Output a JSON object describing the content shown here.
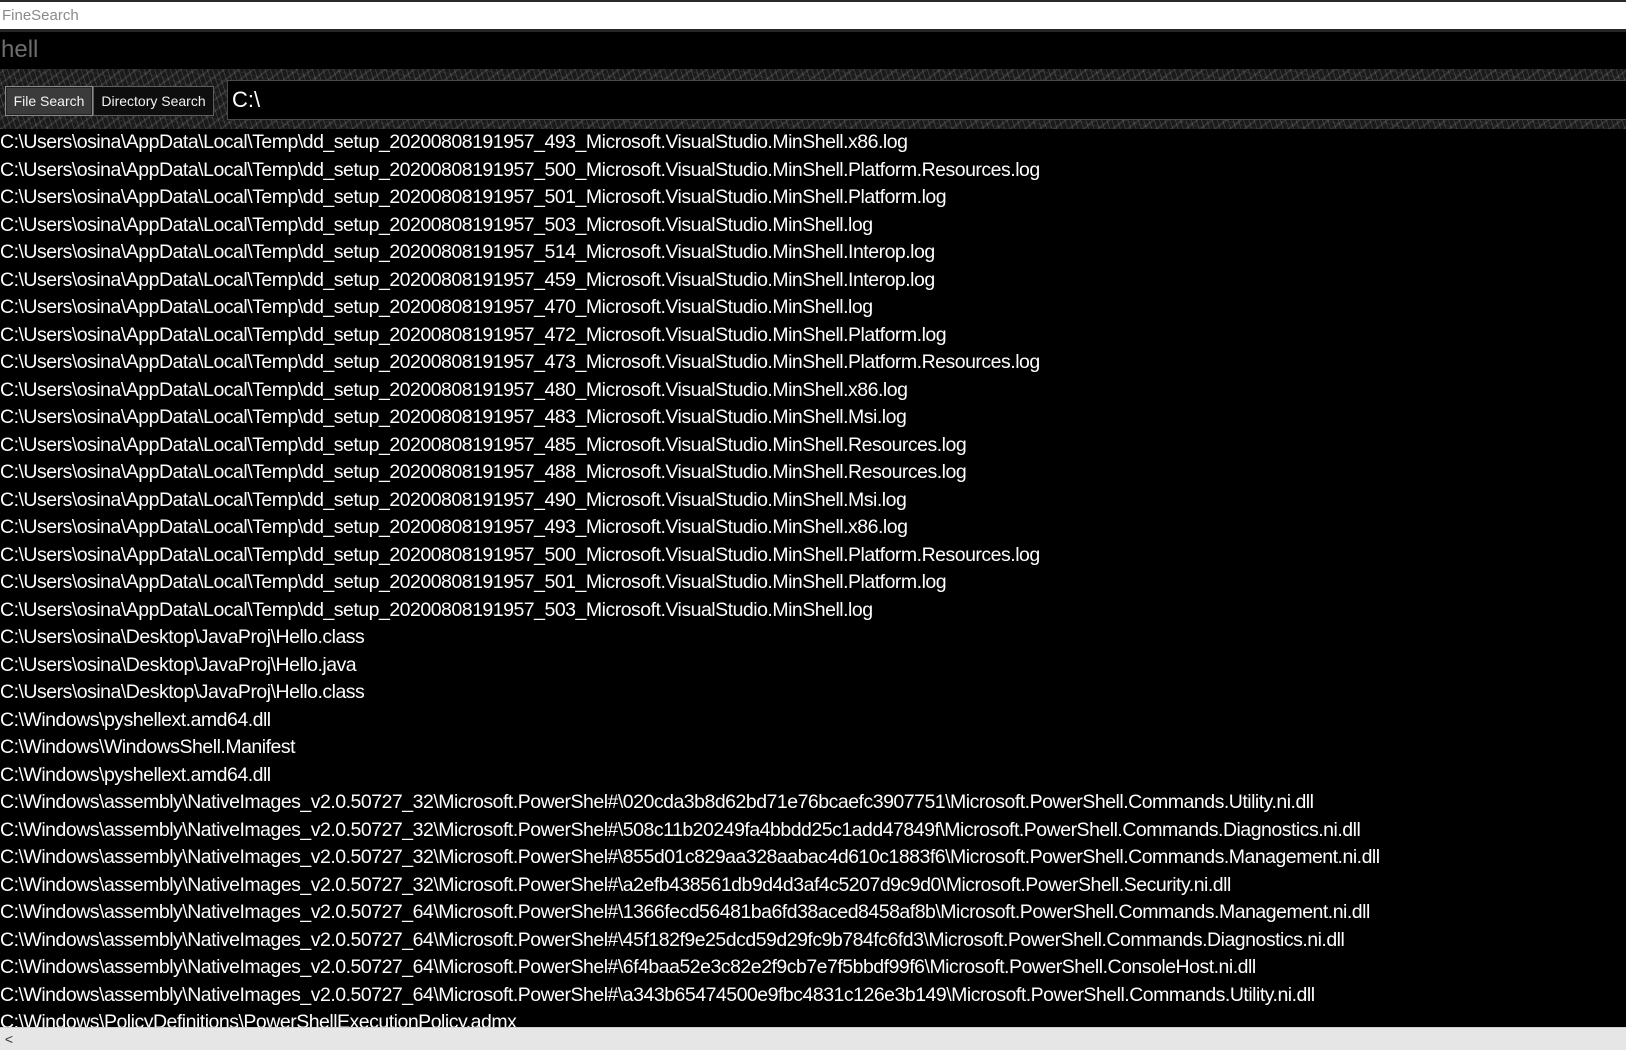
{
  "window": {
    "title": "FineSearch"
  },
  "query": {
    "text": "hell"
  },
  "toolbar": {
    "file_search_label": "File Search",
    "directory_search_label": "Directory Search"
  },
  "path_input": {
    "value": "C:\\"
  },
  "results": [
    "C:\\Users\\osina\\AppData\\Local\\Temp\\dd_setup_20200808191957_493_Microsoft.VisualStudio.MinShell.x86.log",
    "C:\\Users\\osina\\AppData\\Local\\Temp\\dd_setup_20200808191957_500_Microsoft.VisualStudio.MinShell.Platform.Resources.log",
    "C:\\Users\\osina\\AppData\\Local\\Temp\\dd_setup_20200808191957_501_Microsoft.VisualStudio.MinShell.Platform.log",
    "C:\\Users\\osina\\AppData\\Local\\Temp\\dd_setup_20200808191957_503_Microsoft.VisualStudio.MinShell.log",
    "C:\\Users\\osina\\AppData\\Local\\Temp\\dd_setup_20200808191957_514_Microsoft.VisualStudio.MinShell.Interop.log",
    "C:\\Users\\osina\\AppData\\Local\\Temp\\dd_setup_20200808191957_459_Microsoft.VisualStudio.MinShell.Interop.log",
    "C:\\Users\\osina\\AppData\\Local\\Temp\\dd_setup_20200808191957_470_Microsoft.VisualStudio.MinShell.log",
    "C:\\Users\\osina\\AppData\\Local\\Temp\\dd_setup_20200808191957_472_Microsoft.VisualStudio.MinShell.Platform.log",
    "C:\\Users\\osina\\AppData\\Local\\Temp\\dd_setup_20200808191957_473_Microsoft.VisualStudio.MinShell.Platform.Resources.log",
    "C:\\Users\\osina\\AppData\\Local\\Temp\\dd_setup_20200808191957_480_Microsoft.VisualStudio.MinShell.x86.log",
    "C:\\Users\\osina\\AppData\\Local\\Temp\\dd_setup_20200808191957_483_Microsoft.VisualStudio.MinShell.Msi.log",
    "C:\\Users\\osina\\AppData\\Local\\Temp\\dd_setup_20200808191957_485_Microsoft.VisualStudio.MinShell.Resources.log",
    "C:\\Users\\osina\\AppData\\Local\\Temp\\dd_setup_20200808191957_488_Microsoft.VisualStudio.MinShell.Resources.log",
    "C:\\Users\\osina\\AppData\\Local\\Temp\\dd_setup_20200808191957_490_Microsoft.VisualStudio.MinShell.Msi.log",
    "C:\\Users\\osina\\AppData\\Local\\Temp\\dd_setup_20200808191957_493_Microsoft.VisualStudio.MinShell.x86.log",
    "C:\\Users\\osina\\AppData\\Local\\Temp\\dd_setup_20200808191957_500_Microsoft.VisualStudio.MinShell.Platform.Resources.log",
    "C:\\Users\\osina\\AppData\\Local\\Temp\\dd_setup_20200808191957_501_Microsoft.VisualStudio.MinShell.Platform.log",
    "C:\\Users\\osina\\AppData\\Local\\Temp\\dd_setup_20200808191957_503_Microsoft.VisualStudio.MinShell.log",
    "C:\\Users\\osina\\Desktop\\JavaProj\\Hello.class",
    "C:\\Users\\osina\\Desktop\\JavaProj\\Hello.java",
    "C:\\Users\\osina\\Desktop\\JavaProj\\Hello.class",
    "C:\\Windows\\pyshellext.amd64.dll",
    "C:\\Windows\\WindowsShell.Manifest",
    "C:\\Windows\\pyshellext.amd64.dll",
    "C:\\Windows\\assembly\\NativeImages_v2.0.50727_32\\Microsoft.PowerShel#\\020cda3b8d62bd71e76bcaefc3907751\\Microsoft.PowerShell.Commands.Utility.ni.dll",
    "C:\\Windows\\assembly\\NativeImages_v2.0.50727_32\\Microsoft.PowerShel#\\508c11b20249fa4bbdd25c1add47849f\\Microsoft.PowerShell.Commands.Diagnostics.ni.dll",
    "C:\\Windows\\assembly\\NativeImages_v2.0.50727_32\\Microsoft.PowerShel#\\855d01c829aa328aabac4d610c1883f6\\Microsoft.PowerShell.Commands.Management.ni.dll",
    "C:\\Windows\\assembly\\NativeImages_v2.0.50727_32\\Microsoft.PowerShel#\\a2efb438561db9d4d3af4c5207d9c9d0\\Microsoft.PowerShell.Security.ni.dll",
    "C:\\Windows\\assembly\\NativeImages_v2.0.50727_64\\Microsoft.PowerShel#\\1366fecd56481ba6fd38aced8458af8b\\Microsoft.PowerShell.Commands.Management.ni.dll",
    "C:\\Windows\\assembly\\NativeImages_v2.0.50727_64\\Microsoft.PowerShel#\\45f182f9e25dcd59d29fc9b784fc6fd3\\Microsoft.PowerShell.Commands.Diagnostics.ni.dll",
    "C:\\Windows\\assembly\\NativeImages_v2.0.50727_64\\Microsoft.PowerShel#\\6f4baa52e3c82e2f9cb7e7f5bbdf99f6\\Microsoft.PowerShell.ConsoleHost.ni.dll",
    "C:\\Windows\\assembly\\NativeImages_v2.0.50727_64\\Microsoft.PowerShel#\\a343b65474500e9fbc4831c126e3b149\\Microsoft.PowerShell.Commands.Utility.ni.dll",
    "C:\\Windows\\PolicyDefinitions\\PowerShellExecutionPolicy.admx"
  ],
  "scrollbar": {
    "left_arrow_icon": "chevron-left-icon",
    "left_arrow_glyph": "<"
  }
}
